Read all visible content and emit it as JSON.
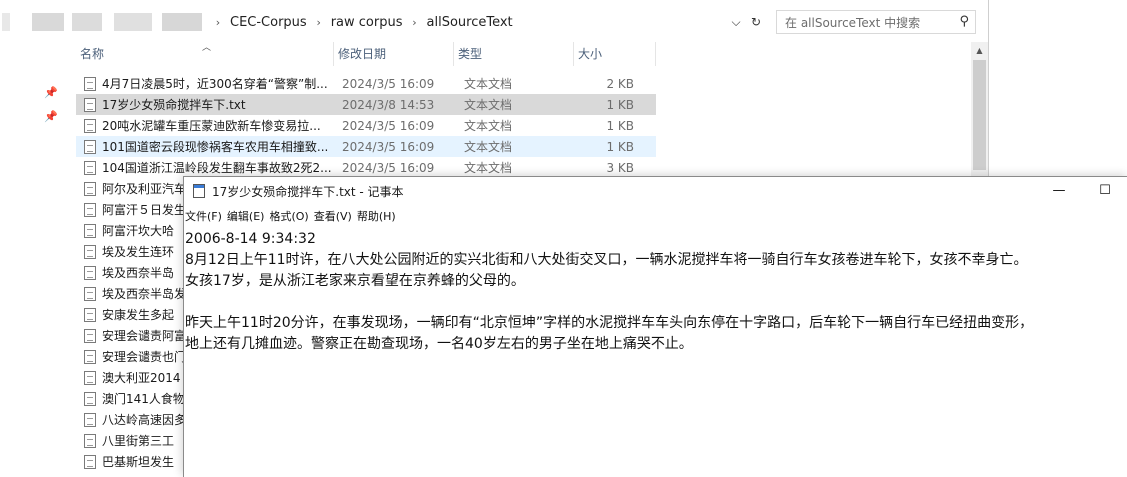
{
  "explorer": {
    "breadcrumb": [
      "CEC-Corpus",
      "raw corpus",
      "allSourceText"
    ],
    "search_placeholder": "在 allSourceText 中搜索",
    "columns": {
      "name": "名称",
      "date": "修改日期",
      "type": "类型",
      "size": "大小"
    },
    "files": [
      {
        "name": "4月7日凌晨5时，近300名穿着“警察”制...",
        "date": "2024/3/5 16:09",
        "type": "文本文档",
        "size": "2 KB"
      },
      {
        "name": "17岁少女殒命搅拌车下.txt",
        "date": "2024/3/8 14:53",
        "type": "文本文档",
        "size": "1 KB"
      },
      {
        "name": "20吨水泥罐车重压蒙迪欧新车惨变易拉...",
        "date": "2024/3/5 16:09",
        "type": "文本文档",
        "size": "1 KB"
      },
      {
        "name": "101国道密云段现惨祸客车农用车相撞致...",
        "date": "2024/3/5 16:09",
        "type": "文本文档",
        "size": "1 KB"
      },
      {
        "name": "104国道浙江温岭段发生翻车事故致2死2...",
        "date": "2024/3/5 16:09",
        "type": "文本文档",
        "size": "3 KB"
      },
      {
        "name": "阿尔及利亚汽车",
        "date": "",
        "type": "",
        "size": ""
      },
      {
        "name": "阿富汗５日发生",
        "date": "",
        "type": "",
        "size": ""
      },
      {
        "name": "阿富汗坎大哈",
        "date": "",
        "type": "",
        "size": ""
      },
      {
        "name": "埃及发生连环",
        "date": "",
        "type": "",
        "size": ""
      },
      {
        "name": "埃及西奈半岛",
        "date": "",
        "type": "",
        "size": ""
      },
      {
        "name": "埃及西奈半岛发",
        "date": "",
        "type": "",
        "size": ""
      },
      {
        "name": "安康发生多起",
        "date": "",
        "type": "",
        "size": ""
      },
      {
        "name": "安理会谴责阿富",
        "date": "",
        "type": "",
        "size": ""
      },
      {
        "name": "安理会谴责也门",
        "date": "",
        "type": "",
        "size": ""
      },
      {
        "name": "澳大利亚2014",
        "date": "",
        "type": "",
        "size": ""
      },
      {
        "name": "澳门141人食物",
        "date": "",
        "type": "",
        "size": ""
      },
      {
        "name": "八达岭高速因多",
        "date": "",
        "type": "",
        "size": ""
      },
      {
        "name": "八里街第三工",
        "date": "",
        "type": "",
        "size": ""
      },
      {
        "name": "巴基斯坦发生",
        "date": "",
        "type": "",
        "size": ""
      }
    ]
  },
  "notepad": {
    "title": "17岁少女殒命搅拌车下.txt - 记事本",
    "menu": [
      "文件(F)",
      "编辑(E)",
      "格式(O)",
      "查看(V)",
      "帮助(H)"
    ],
    "lines": [
      "2006-8-14 9:34:32",
      "8月12日上午11时许，在八大处公园附近的实兴北街和八大处街交叉口，一辆水泥搅拌车将一骑自行车女孩卷进车轮下，女孩不幸身亡。",
      "女孩17岁，是从浙江老家来京看望在京养蜂的父母的。",
      "",
      "昨天上午11时20分许，在事发现场，一辆印有“北京恒坤”字样的水泥搅拌车车头向东停在十字路口，后车轮下一辆自行车已经扭曲变形，",
      "地上还有几摊血迹。警察正在勘查现场，一名40岁左右的男子坐在地上痛哭不止。"
    ]
  }
}
